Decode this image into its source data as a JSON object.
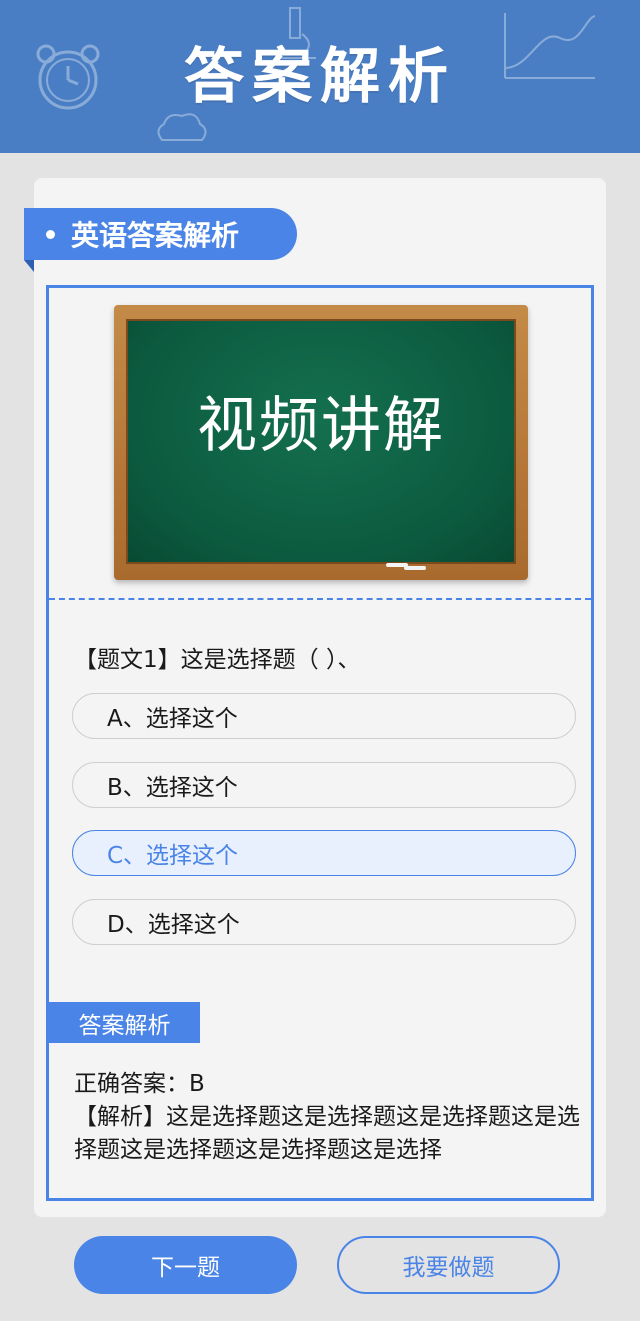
{
  "header": {
    "title": "答案解析"
  },
  "section": {
    "title": "英语答案解析"
  },
  "video": {
    "label": "视频讲解"
  },
  "question": {
    "text": "【题文1】这是选择题（ ）、",
    "options": [
      {
        "label": "A、选择这个",
        "selected": false
      },
      {
        "label": "B、选择这个",
        "selected": false
      },
      {
        "label": "C、选择这个",
        "selected": true
      },
      {
        "label": "D、选择这个",
        "selected": false
      }
    ]
  },
  "analysis": {
    "heading": "答案解析",
    "correct": "正确答案：B",
    "explanation": "【解析】这是选择题这是选择题这是选择题这是选择题这是选择题这是选择题这是选择"
  },
  "actions": {
    "next": "下一题",
    "practice": "我要做题"
  },
  "colors": {
    "accent": "#4a84e6",
    "header": "#4a7ec4",
    "board": "#0c5a3f"
  }
}
